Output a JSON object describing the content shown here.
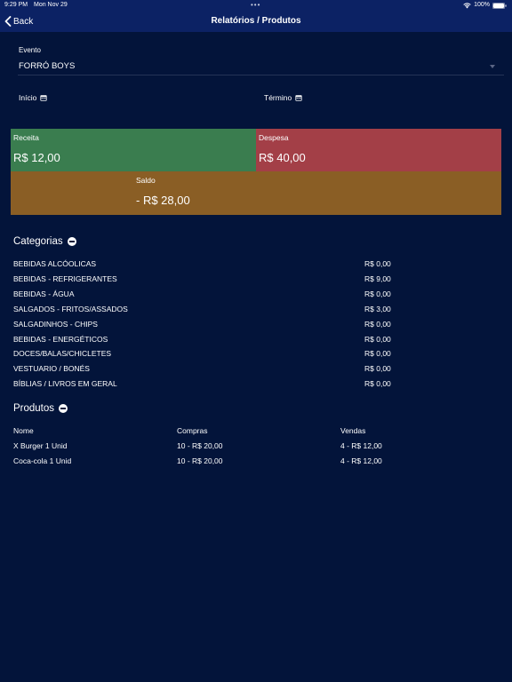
{
  "status_bar": {
    "time": "9:29 PM",
    "date": "Mon Nov 29",
    "dots": "•••",
    "battery": "100%"
  },
  "nav": {
    "back_label": "Back",
    "title": "Relatórios / Produtos"
  },
  "filters": {
    "event_label": "Evento",
    "event_value": "FORRÓ BOYS",
    "start_label": "Início",
    "end_label": "Término"
  },
  "summary": {
    "receita_label": "Receita",
    "receita_value": "R$ 12,00",
    "despesa_label": "Despesa",
    "despesa_value": "R$ 40,00",
    "saldo_label": "Saldo",
    "saldo_value": "- R$ 28,00"
  },
  "categories": {
    "title": "Categorias",
    "rows": [
      {
        "name": "BEBIDAS ALCÓOLICAS",
        "value": "R$ 0,00"
      },
      {
        "name": "BEBIDAS - REFRIGERANTES",
        "value": "R$ 9,00"
      },
      {
        "name": "BEBIDAS - ÁGUA",
        "value": "R$ 0,00"
      },
      {
        "name": "SALGADOS - FRITOS/ASSADOS",
        "value": "R$ 3,00"
      },
      {
        "name": "SALGADINHOS - CHIPS",
        "value": "R$ 0,00"
      },
      {
        "name": "BEBIDAS - ENERGÉTICOS",
        "value": "R$ 0,00"
      },
      {
        "name": "DOCES/BALAS/CHICLETES",
        "value": "R$ 0,00"
      },
      {
        "name": "VESTUARIO / BONÉS",
        "value": "R$ 0,00"
      },
      {
        "name": "BÍBLIAS / LIVROS EM GERAL",
        "value": "R$ 0,00"
      }
    ]
  },
  "products": {
    "title": "Produtos",
    "headers": [
      "Nome",
      "Compras",
      "Vendas"
    ],
    "rows": [
      {
        "name": "X Burger 1 Unid",
        "compras": "10 - R$ 20,00",
        "vendas": "4 - R$ 12,00"
      },
      {
        "name": "Coca-cola 1 Unid",
        "compras": "10 - R$ 20,00",
        "vendas": "4 - R$ 12,00"
      }
    ]
  },
  "colors": {
    "background": "#03143a",
    "nav_bar": "#0c2264",
    "receita": "#3a7d4f",
    "despesa": "#a33f47",
    "saldo": "#8a5e25"
  }
}
